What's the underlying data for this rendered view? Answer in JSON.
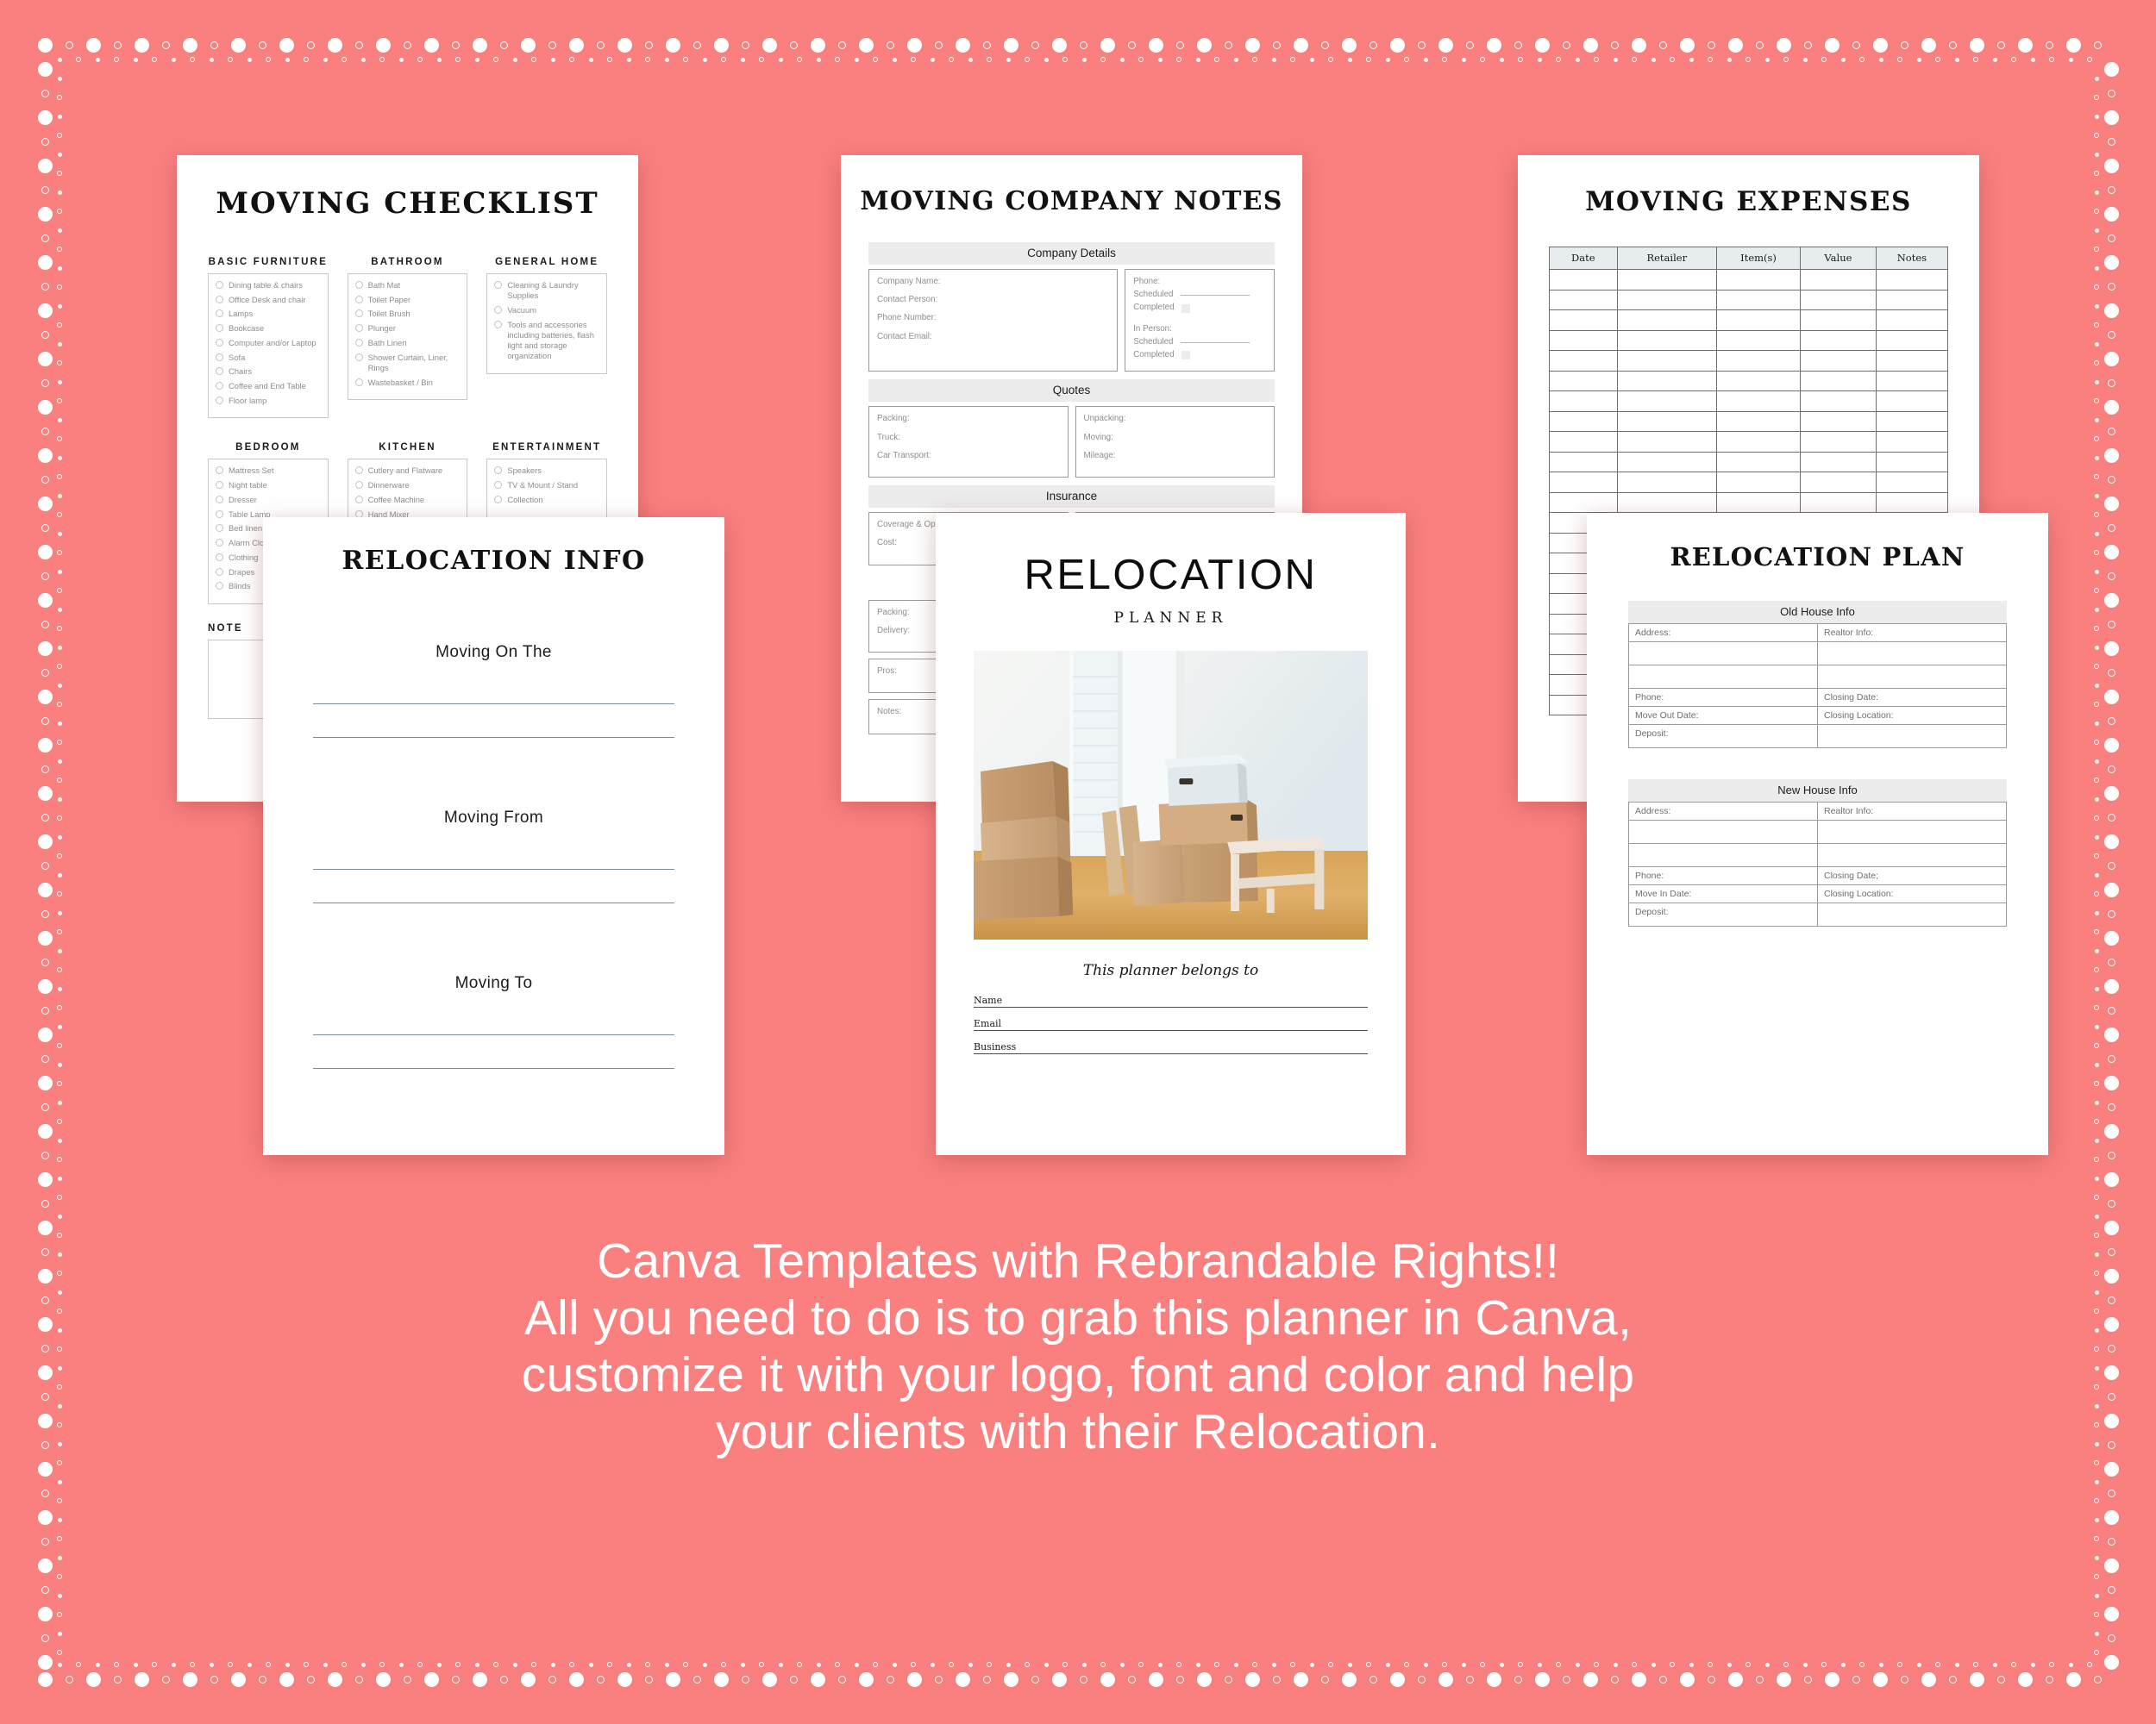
{
  "background_color": "#FA8080",
  "checklist": {
    "title": "MOVING CHECKLIST",
    "note_label": "NOTE",
    "columns": [
      {
        "heading": "BASIC FURNITURE",
        "items": [
          "Dining table & chairs",
          "Office Desk and chair",
          "Lamps",
          "Bookcase",
          "Computer and/or Laptop",
          "Sofa",
          "Chairs",
          "Coffee and End Table",
          "Floor lamp"
        ]
      },
      {
        "heading": "BATHROOM",
        "items": [
          "Bath Mat",
          "Toilet Paper",
          "Toilet Brush",
          "Plunger",
          "Bath Linen",
          "Shower Curtain, Liner, Rings",
          "Wastebasket / Bin"
        ]
      },
      {
        "heading": "GENERAL HOME",
        "items": [
          "Cleaning & Laundry Supplies",
          "Vacuum",
          "Tools and accessories including batteries, flash light and storage organization"
        ]
      },
      {
        "heading": "BEDROOM",
        "items": [
          "Mattress Set",
          "Night table",
          "Dresser",
          "Table Lamp",
          "Bed linen",
          "Alarm Clock",
          "Clothing",
          "Drapes",
          "Blinds"
        ]
      },
      {
        "heading": "KITCHEN",
        "items": [
          "Cutlery and Flatware",
          "Dinnerware",
          "Coffee Machine",
          "Hand Mixer"
        ]
      },
      {
        "heading": "ENTERTAINMENT",
        "items": [
          "Speakers",
          "TV & Mount / Stand",
          "Collection"
        ]
      }
    ]
  },
  "relocation_info": {
    "title": "RELOCATION INFO",
    "sections": [
      {
        "label": "Moving On The"
      },
      {
        "label": "Moving From"
      },
      {
        "label": "Moving To"
      }
    ]
  },
  "company_notes": {
    "title": "MOVING COMPANY NOTES",
    "company_details": {
      "band": "Company Details",
      "left_fields": [
        "Company Name:",
        "Contact Person:",
        "Phone Number:",
        "Contact Email:"
      ],
      "right": {
        "phone_label": "Phone:",
        "scheduled_label": "Scheduled",
        "completed_label": "Completed",
        "in_person_label": "In Person:"
      }
    },
    "quotes": {
      "band": "Quotes",
      "left_fields": [
        "Packing:",
        "Truck:",
        "Car Transport:"
      ],
      "right_fields": [
        "Unpacking:",
        "Moving:",
        "Mileage:"
      ]
    },
    "insurance": {
      "band": "Insurance",
      "fields": [
        "Coverage & Options:",
        "Cost:"
      ]
    },
    "schedule": {
      "left_fields": [
        "Packing:",
        "Delivery:"
      ]
    },
    "pros_label": "Pros:",
    "notes_label": "Notes:"
  },
  "expenses": {
    "title": "MOVING EXPENSES",
    "columns": [
      "Date",
      "Retailer",
      "Item(s)",
      "Value",
      "Notes"
    ],
    "row_count": 22
  },
  "cover": {
    "title": "RELOCATION",
    "subtitle": "PLANNER",
    "belongs_to": "This planner belongs to",
    "fields": [
      "Name",
      "Email",
      "Business"
    ],
    "photo_alt": "moving boxes and step stool in bright room"
  },
  "plan": {
    "title": "RELOCATION PLAN",
    "old_house": {
      "band": "Old House Info",
      "rows": [
        [
          "Address:",
          "Realtor Info:"
        ],
        [
          "",
          ""
        ],
        [
          "",
          ""
        ],
        [
          "Phone:",
          "Closing Date:"
        ],
        [
          "Move Out Date:",
          "Closing Location:"
        ],
        [
          "Deposit:",
          ""
        ]
      ]
    },
    "new_house": {
      "band": "New House Info",
      "rows": [
        [
          "Address:",
          "Realtor Info:"
        ],
        [
          "",
          ""
        ],
        [
          "",
          ""
        ],
        [
          "Phone:",
          "Closing Date;"
        ],
        [
          "Move In Date:",
          "Closing Location:"
        ],
        [
          "Deposit:",
          ""
        ]
      ]
    }
  },
  "caption": {
    "line1": "Canva Templates with Rebrandable Rights!!",
    "line2": "All you need to do is to grab this planner in Canva,",
    "line3": "customize it with your logo, font and color and help",
    "line4": "your clients with their Relocation."
  }
}
